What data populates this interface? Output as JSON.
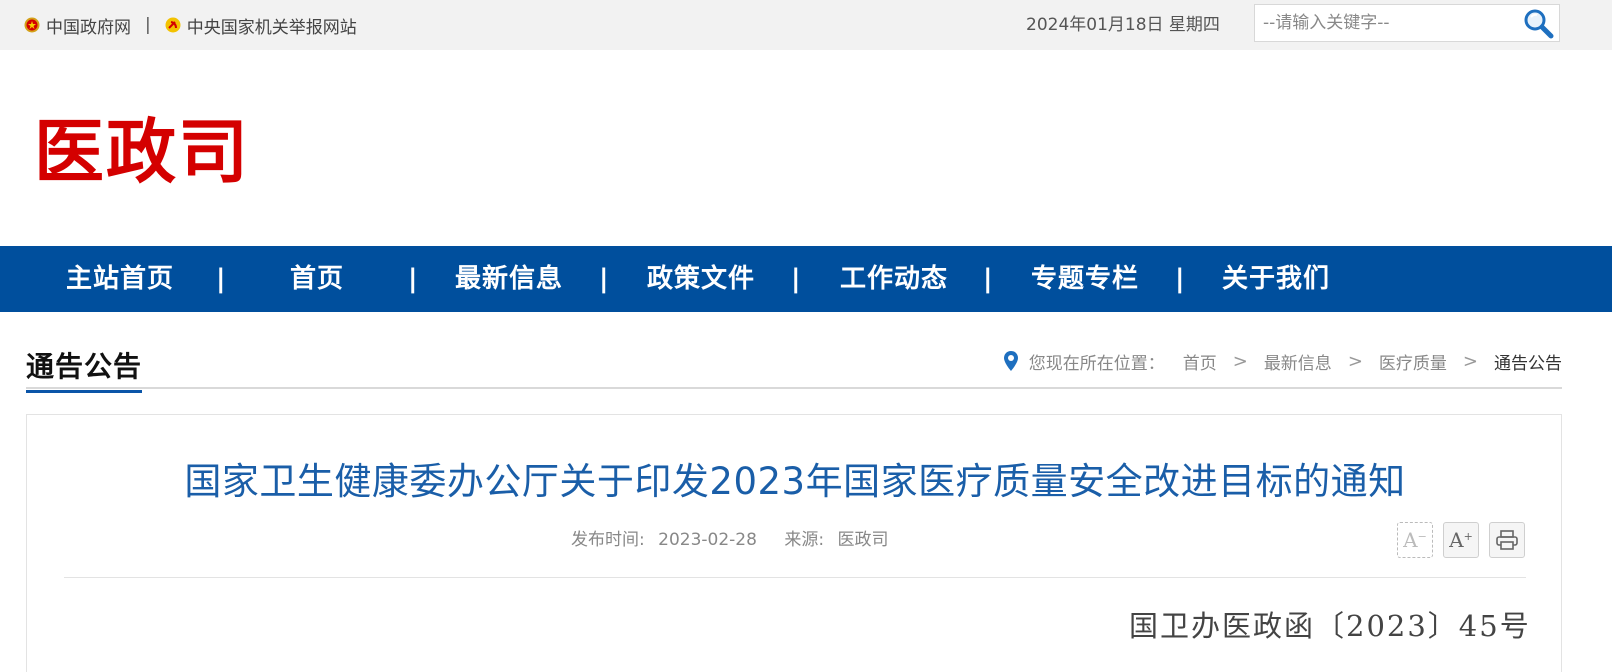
{
  "topbar": {
    "gov_link": "中国政府网",
    "separator": "|",
    "report_link": "中央国家机关举报网站",
    "date": "2024年01月18日 星期四",
    "search_placeholder": "--请输入关键字--"
  },
  "logo": {
    "text": "医政司",
    "color": "#d40000"
  },
  "nav": {
    "items": [
      "主站首页",
      "首页",
      "最新信息",
      "政策文件",
      "工作动态",
      "专题专栏",
      "关于我们"
    ],
    "separator": "|",
    "background": "#004f9d"
  },
  "section": {
    "title": "通告公告",
    "breadcrumb_prefix": "您现在所在位置：",
    "breadcrumb": [
      "首页",
      "最新信息",
      "医疗质量",
      "通告公告"
    ],
    "breadcrumb_separator": ">"
  },
  "article": {
    "title": "国家卫生健康委办公厅关于印发2023年国家医疗质量安全改进目标的通知",
    "publish_label": "发布时间:",
    "publish_date": "2023-02-28",
    "source_label": "来源:",
    "source": "医政司",
    "font_decrease": "A",
    "font_increase": "A",
    "doc_number": "国卫办医政函〔2023〕45号"
  },
  "colors": {
    "accent": "#004f9d",
    "title_blue": "#1a5ea8",
    "logo_red": "#d40000"
  },
  "icons": [
    "emblem-icon",
    "party-emblem-icon",
    "search-icon",
    "location-pin-icon",
    "print-icon"
  ]
}
